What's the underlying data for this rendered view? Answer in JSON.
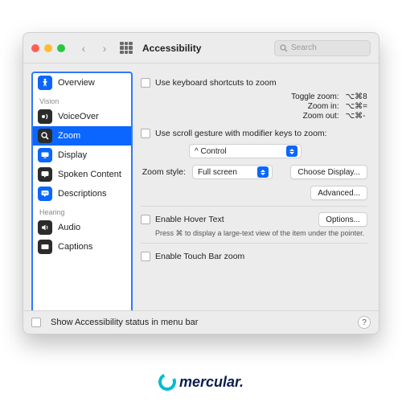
{
  "window": {
    "title": "Accessibility"
  },
  "search": {
    "placeholder": "Search"
  },
  "sidebar": {
    "groups": {
      "vision": "Vision",
      "hearing": "Hearing"
    },
    "items": [
      {
        "label": "Overview"
      },
      {
        "label": "VoiceOver"
      },
      {
        "label": "Zoom"
      },
      {
        "label": "Display"
      },
      {
        "label": "Spoken Content"
      },
      {
        "label": "Descriptions"
      },
      {
        "label": "Audio"
      },
      {
        "label": "Captions"
      }
    ]
  },
  "pane": {
    "use_kb": "Use keyboard shortcuts to zoom",
    "kb": {
      "toggle_l": "Toggle zoom:",
      "toggle_v": "⌥⌘8",
      "in_l": "Zoom in:",
      "in_v": "⌥⌘=",
      "out_l": "Zoom out:",
      "out_v": "⌥⌘-"
    },
    "use_scroll": "Use scroll gesture with modifier keys to zoom:",
    "modifier": "^ Control",
    "zoom_style_l": "Zoom style:",
    "zoom_style_v": "Full screen",
    "choose_display": "Choose Display...",
    "advanced": "Advanced...",
    "hover": "Enable Hover Text",
    "options": "Options...",
    "hover_hint": "Press ⌘ to display a large-text view of the item under the pointer.",
    "touchbar": "Enable Touch Bar zoom"
  },
  "footer": {
    "show_status": "Show Accessibility status in menu bar"
  },
  "brand": "mercular."
}
